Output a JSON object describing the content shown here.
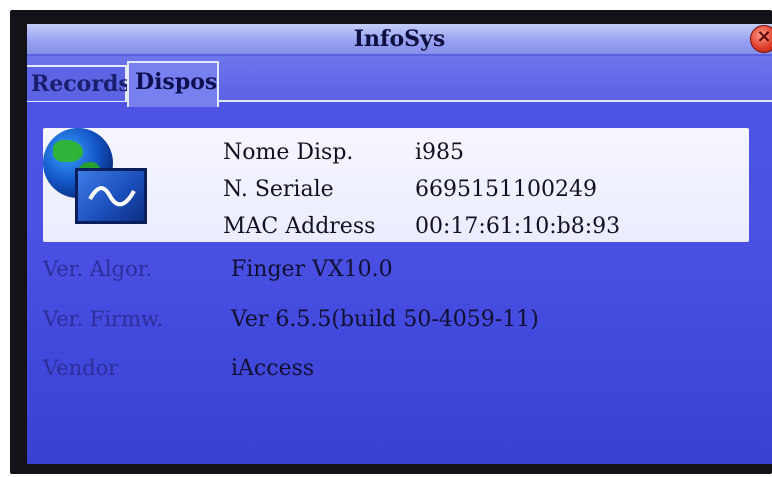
{
  "window": {
    "title": "InfoSys",
    "close_symbol": "×"
  },
  "tabs": [
    {
      "label": "Records",
      "active": false
    },
    {
      "label": "Dispos",
      "active": true
    }
  ],
  "device": {
    "name_label": "Nome Disp.",
    "name_value": "i985",
    "serial_label": "N. Seriale",
    "serial_value": "6695151100249",
    "mac_label": "MAC Address",
    "mac_value": "00:17:61:10:b8:93"
  },
  "details": {
    "algo_label": "Ver. Algor.",
    "algo_value": "Finger VX10.0",
    "firmware_label": "Ver. Firmw.",
    "firmware_value": "Ver 6.5.5(build 50-4059-11)",
    "vendor_label": "Vendor",
    "vendor_value": "iAccess"
  },
  "colors": {
    "screen_bg": "#4b52e4",
    "titlebar": "#98a2f2",
    "panel": "#f0f1ff",
    "close_button": "#e0402c"
  },
  "icons": [
    "globe-icon",
    "monitor-icon",
    "close-icon"
  ]
}
